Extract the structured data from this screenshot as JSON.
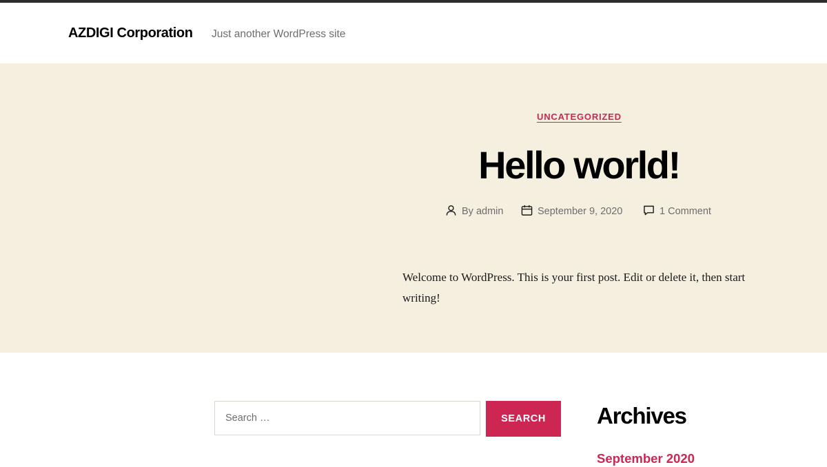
{
  "header": {
    "site_title": "AZDIGI Corporation",
    "site_description": "Just another WordPress site"
  },
  "post": {
    "category": "UNCATEGORIZED",
    "title": "Hello world!",
    "meta": {
      "author": "By admin",
      "date": "September 9, 2020",
      "comments": "1 Comment"
    },
    "excerpt": "Welcome to WordPress. This is your first post. Edit or delete it, then start writing!"
  },
  "search": {
    "placeholder": "Search …",
    "button_label": "SEARCH"
  },
  "archives": {
    "title": "Archives",
    "items": [
      "September 2020"
    ]
  },
  "colors": {
    "accent": "#cd2653",
    "hero_background": "#f5efe0",
    "meta_text": "#6d6d6d"
  }
}
